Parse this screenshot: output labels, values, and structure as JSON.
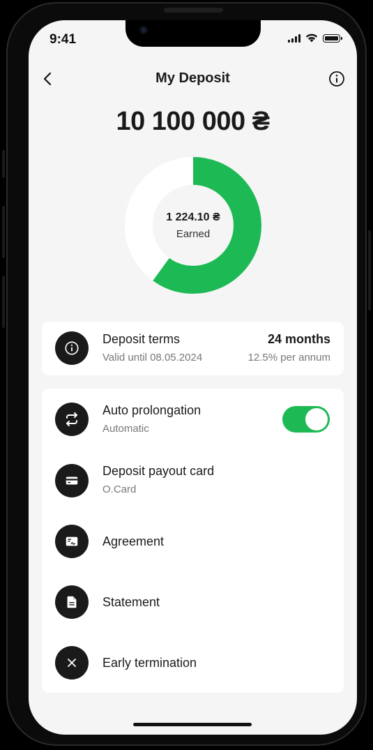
{
  "status_bar": {
    "time": "9:41"
  },
  "nav": {
    "title": "My Deposit"
  },
  "deposit": {
    "amount": "10 100 000 ₴",
    "earned_value": "1 224.10 ₴",
    "earned_label": "Earned",
    "progress_fraction": 0.6
  },
  "terms": {
    "title": "Deposit terms",
    "valid": "Valid until 08.05.2024",
    "duration": "24 months",
    "rate": "12.5% per annum"
  },
  "items": [
    {
      "title": "Auto prolongation",
      "subtitle": "Automatic",
      "icon": "repeat-icon",
      "toggle_on": true
    },
    {
      "title": "Deposit payout card",
      "subtitle": "O.Card",
      "icon": "card-icon"
    },
    {
      "title": "Agreement",
      "icon": "signature-icon"
    },
    {
      "title": "Statement",
      "icon": "document-icon"
    },
    {
      "title": "Early termination",
      "icon": "close-icon"
    }
  ],
  "colors": {
    "accent": "#1db954",
    "ring_bg": "#ffffff",
    "screen_bg": "#f5f5f5",
    "icon_bg": "#1a1a1a"
  }
}
